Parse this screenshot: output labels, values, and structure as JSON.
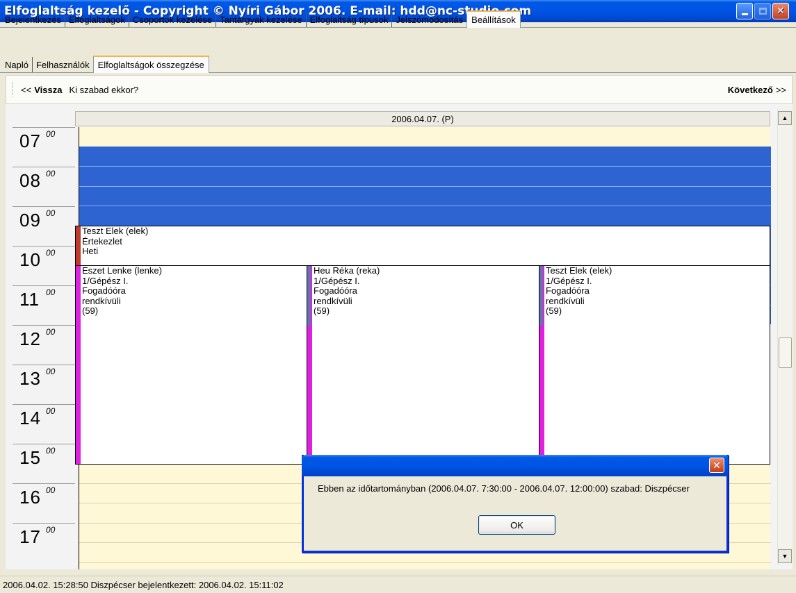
{
  "window": {
    "title": "Elfoglaltság kezelő - Copyright © Nyíri Gábor 2006. E-mail: hdd@nc-studio.com"
  },
  "main_tabs": [
    {
      "label": "Bejelentkezés",
      "active": false
    },
    {
      "label": "Elfoglaltságok",
      "active": false
    },
    {
      "label": "Csoportok kezelése",
      "active": false
    },
    {
      "label": "Tantárgyak kezelése",
      "active": false
    },
    {
      "label": "Elfoglaltság típusok",
      "active": false
    },
    {
      "label": "Jelszómódosítás",
      "active": false
    },
    {
      "label": "Beállítások",
      "active": true
    }
  ],
  "sub_tabs": [
    {
      "label": "Napló",
      "active": false
    },
    {
      "label": "Felhasználók",
      "active": false
    },
    {
      "label": "Elfoglaltságok összegzése",
      "active": true
    }
  ],
  "toolbar": {
    "back_arrows": "<<",
    "back_label": "Vissza",
    "question": "Ki szabad ekkor?",
    "next_label": "Következő",
    "next_arrows": ">>"
  },
  "schedule": {
    "date_header": "2006.04.07. (P)",
    "hours": [
      {
        "h": "07",
        "m": "00"
      },
      {
        "h": "08",
        "m": "00"
      },
      {
        "h": "09",
        "m": "00"
      },
      {
        "h": "10",
        "m": "00"
      },
      {
        "h": "11",
        "m": "00"
      },
      {
        "h": "12",
        "m": "00"
      },
      {
        "h": "13",
        "m": "00"
      },
      {
        "h": "14",
        "m": "00"
      },
      {
        "h": "15",
        "m": "00"
      },
      {
        "h": "16",
        "m": "00"
      },
      {
        "h": "17",
        "m": "00"
      }
    ],
    "events": {
      "meeting": {
        "lines": [
          "Teszt Elek (elek)",
          "Értekezlet",
          "Heti"
        ],
        "bar_color": "#c0392b"
      },
      "col1": {
        "lines": [
          "Eszet Lenke (lenke)",
          "1/Gépész I.",
          "Fogadóóra",
          "rendkívüli",
          "(59)"
        ],
        "bar_color": "#e020e0"
      },
      "col2": {
        "lines": [
          "Heu Réka (reka)",
          "1/Gépész I.",
          "Fogadóóra",
          "rendkívüli",
          "(59)"
        ],
        "bar_color": "#e020e0"
      },
      "col3": {
        "lines": [
          "Teszt Elek (elek)",
          "1/Gépész I.",
          "Fogadóóra",
          "rendkívüli",
          "(59)"
        ],
        "bar_color": "#e020e0"
      }
    },
    "busy_color": "#2e64d2",
    "free_color": "#fff8d6"
  },
  "dialog": {
    "message": "Ebben az időtartományban (2006.04.07. 7:30:00 - 2006.04.07. 12:00:00) szabad: Diszpécser",
    "ok_label": "OK"
  },
  "statusbar": {
    "text": "2006.04.02. 15:28:50  Diszpécser bejelentkezett: 2006.04.02. 15:11:02"
  }
}
